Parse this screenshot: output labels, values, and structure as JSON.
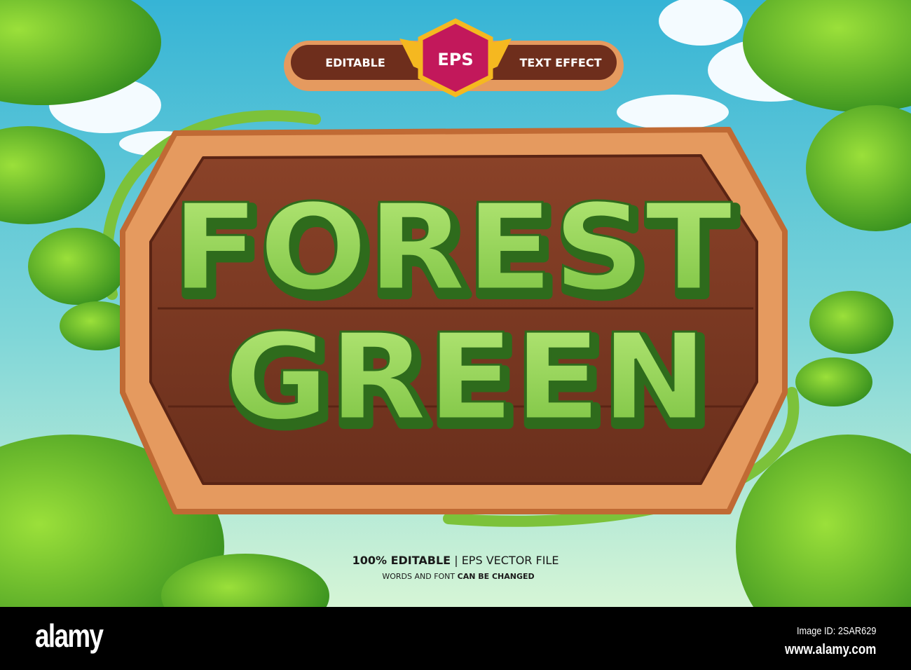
{
  "banner": {
    "left_label": "EDITABLE",
    "badge_label": "EPS",
    "right_label": "TEXT EFFECT"
  },
  "headline": {
    "line1": "FOREST",
    "line2": "GREEN"
  },
  "caption": {
    "line1_bold": "100% EDITABLE",
    "line1_separator": "|",
    "line1_regular": "EPS VECTOR FILE",
    "line2_regular": "WORDS AND FONT",
    "line2_bold": "CAN BE CHANGED"
  },
  "footer": {
    "logo": "alamy",
    "image_id": "Image ID: 2SAR629",
    "url": "www.alamy.com"
  },
  "colors": {
    "sky_top": "#3cb8d8",
    "sky_bottom": "#c8f0d8",
    "wood": "#7a3a22",
    "frame": "#e6a066",
    "text_green": "#8fd24e",
    "text_outline": "#2e6b1c",
    "badge": "#c2185b",
    "gold": "#f5b820"
  }
}
